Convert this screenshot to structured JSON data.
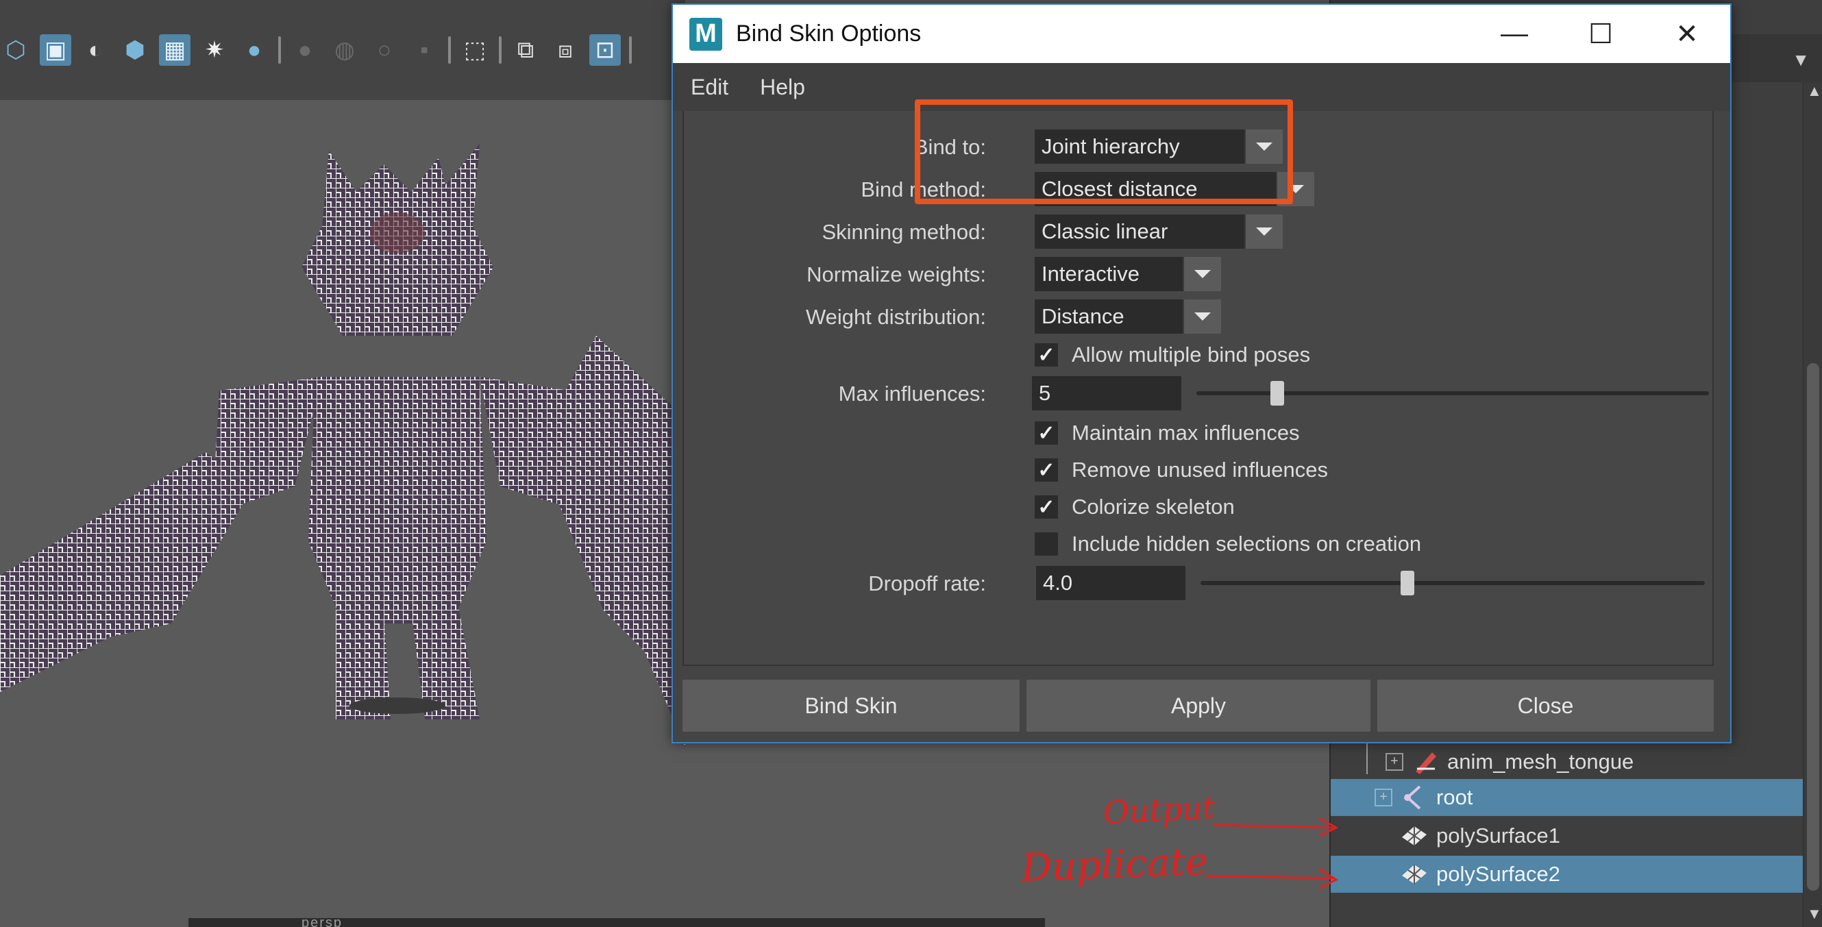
{
  "dialog": {
    "title": "Bind Skin Options",
    "logo_letter": "M",
    "menu": [
      "Edit",
      "Help"
    ],
    "fields": {
      "bind_to": {
        "label": "Bind to:",
        "value": "Joint hierarchy"
      },
      "bind_method": {
        "label": "Bind method:",
        "value": "Closest distance"
      },
      "skinning_method": {
        "label": "Skinning method:",
        "value": "Classic linear"
      },
      "normalize_weights": {
        "label": "Normalize weights:",
        "value": "Interactive"
      },
      "weight_distribution": {
        "label": "Weight distribution:",
        "value": "Distance"
      },
      "allow_multiple_bind_poses": {
        "label": "Allow multiple bind poses",
        "checked": true
      },
      "max_influences": {
        "label": "Max influences:",
        "value": "5",
        "slider_fraction": 0.15
      },
      "maintain_max_influences": {
        "label": "Maintain max influences",
        "checked": true
      },
      "remove_unused_influences": {
        "label": "Remove unused influences",
        "checked": true
      },
      "colorize_skeleton": {
        "label": "Colorize skeleton",
        "checked": true
      },
      "include_hidden_selections": {
        "label": "Include hidden selections on creation",
        "checked": false
      },
      "dropoff_rate": {
        "label": "Dropoff rate:",
        "value": "4.0",
        "slider_fraction": 0.4
      }
    },
    "buttons": {
      "bind_skin": "Bind Skin",
      "apply": "Apply",
      "close": "Close"
    },
    "window_controls": {
      "minimize": "—",
      "maximize": "☐",
      "close": "✕"
    }
  },
  "outliner": {
    "items": [
      {
        "label": "anim_mesh_tongue",
        "selected": false
      },
      {
        "label": "root",
        "selected": true
      },
      {
        "label": "polySurface1",
        "selected": false
      },
      {
        "label": "polySurface2",
        "selected": true
      }
    ]
  },
  "annotations": {
    "output": "Output",
    "duplicate": "Duplicate"
  },
  "viewport": {
    "bottom_label": "persp"
  },
  "colors": {
    "highlight": "#e8531f",
    "selection": "#5285a6",
    "annotation": "#e02020",
    "dialog_border": "#3a7fc4"
  },
  "icons": [
    "wireframe-cube-icon",
    "shaded-cube-icon",
    "half-sphere-icon",
    "textured-cube-icon",
    "checker-icon",
    "light-icon",
    "shadow-icon",
    "select-icon",
    "snap-icon",
    "isolate-icon",
    "frame-icon"
  ]
}
